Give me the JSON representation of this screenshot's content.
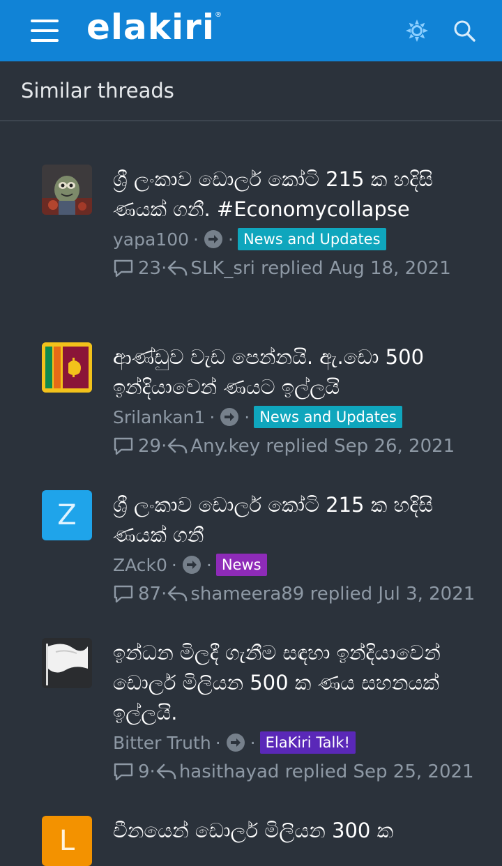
{
  "header": {
    "logo_text": "elakiri",
    "logo_mark": "®",
    "menu_icon": "menu-icon",
    "theme_icon": "sun-icon",
    "search_icon": "search-icon",
    "brand_color": "#1183d6"
  },
  "section_title": "Similar threads",
  "threads": [
    {
      "title": "ශ්‍රී ලංකාව ඩොලර් කෝටි 215 ක හදිසි ණයක් ගනී. #Economycollapse",
      "author": "yapa100",
      "forum": "News and Updates",
      "forum_color": "#0fa6bd",
      "replies": "23",
      "last_reply": "SLK_sri replied Aug 18, 2021",
      "avatar": "photo"
    },
    {
      "title": "ආණ්ඩුව වැඩ පෙන්නයි. ඇ.ඩො 500 ඉන්දියාවෙන් ණයට ඉල්ලයි",
      "author": "Srilankan1",
      "forum": "News and Updates",
      "forum_color": "#0fa6bd",
      "replies": "29",
      "last_reply": "Any.key replied Sep 26, 2021",
      "avatar": "flag"
    },
    {
      "title": "ශ්‍රී ලංකාව ඩොලර් කෝටි 215 ක හදිසි ණයක් ගනී",
      "author": "ZAck0",
      "forum": "News",
      "forum_color": "#8e2bb8",
      "replies": "87",
      "last_reply": "shameera89 replied Jul 3, 2021",
      "avatar": "Z",
      "avatar_color": "#1fa4ea"
    },
    {
      "title": "ඉන්ධන මිලදී ගැනීම සඳහා ඉන්දියාවෙන් ඩොලර් මිලියන 500 ක ණය සහනයක් ඉල්ලයි.",
      "author": "Bitter Truth",
      "forum": "ElaKiri Talk!",
      "forum_color": "#5a28b8",
      "replies": "9",
      "last_reply": "hasithayad replied Sep 25, 2021",
      "avatar": "whiteflag"
    },
    {
      "title": "චීනයෙන් ඩොලර් මිලියන 300 ක",
      "avatar": "L",
      "avatar_color": "#f39200"
    }
  ]
}
